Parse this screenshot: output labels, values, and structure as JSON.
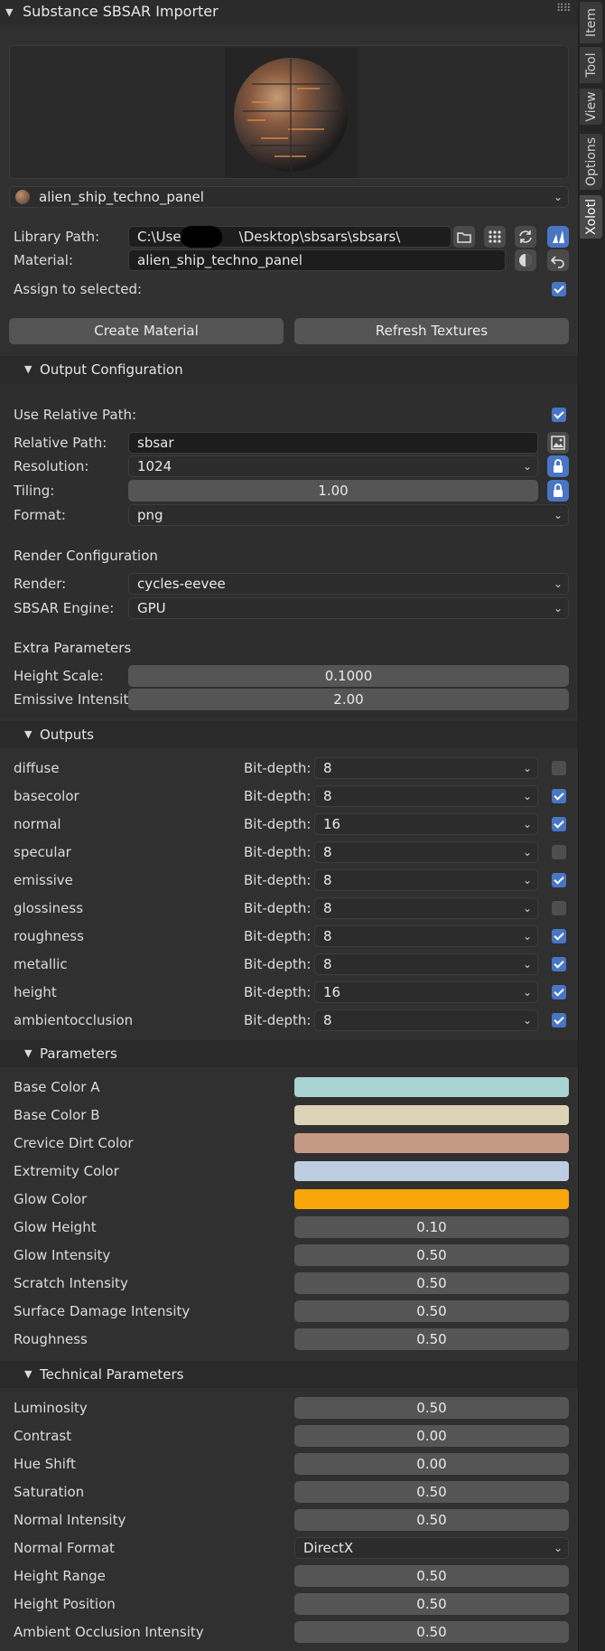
{
  "header": {
    "title": "Substance SBSAR Importer"
  },
  "side_tabs": [
    "Item",
    "Tool",
    "View",
    "Options",
    "Xolotl"
  ],
  "material_select": {
    "value": "alien_ship_techno_panel"
  },
  "library_path": {
    "label": "Library Path:",
    "value": "C:\\Users\\   \\Desktop\\sbsars\\sbsars\\"
  },
  "material": {
    "label": "Material:",
    "value": "alien_ship_techno_panel"
  },
  "assign": {
    "label": "Assign to selected:",
    "checked": true
  },
  "buttons": {
    "create": "Create Material",
    "refresh": "Refresh Textures"
  },
  "output_config": {
    "title": "Output Configuration",
    "use_relative": {
      "label": "Use Relative Path:",
      "checked": true
    },
    "relative_path": {
      "label": "Relative Path:",
      "value": "sbsar"
    },
    "resolution": {
      "label": "Resolution:",
      "value": "1024"
    },
    "tiling": {
      "label": "Tiling:",
      "value": "1.00"
    },
    "format": {
      "label": "Format:",
      "value": "png"
    },
    "render_heading": "Render Configuration",
    "render": {
      "label": "Render:",
      "value": "cycles-eevee"
    },
    "engine": {
      "label": "SBSAR Engine:",
      "value": "GPU"
    },
    "extra_heading": "Extra Parameters",
    "height_scale": {
      "label": "Height Scale:",
      "value": "0.1000"
    },
    "emissive": {
      "label": "Emissive Intensit",
      "value": "2.00"
    }
  },
  "outputs": {
    "title": "Outputs",
    "bit_label": "Bit-depth:",
    "rows": [
      {
        "name": "diffuse",
        "depth": "8",
        "checked": false
      },
      {
        "name": "basecolor",
        "depth": "8",
        "checked": true
      },
      {
        "name": "normal",
        "depth": "16",
        "checked": true
      },
      {
        "name": "specular",
        "depth": "8",
        "checked": false
      },
      {
        "name": "emissive",
        "depth": "8",
        "checked": true
      },
      {
        "name": "glossiness",
        "depth": "8",
        "checked": false
      },
      {
        "name": "roughness",
        "depth": "8",
        "checked": true
      },
      {
        "name": "metallic",
        "depth": "8",
        "checked": true
      },
      {
        "name": "height",
        "depth": "16",
        "checked": true
      },
      {
        "name": "ambientocclusion",
        "depth": "8",
        "checked": true
      }
    ]
  },
  "parameters": {
    "title": "Parameters",
    "colors": [
      {
        "label": "Base Color A",
        "color": "#a9d3d2"
      },
      {
        "label": "Base Color B",
        "color": "#dcd2b8"
      },
      {
        "label": "Crevice Dirt Color",
        "color": "#c49a84"
      },
      {
        "label": "Extremity Color",
        "color": "#bfcde2"
      },
      {
        "label": "Glow Color",
        "color": "#f8a60a"
      }
    ],
    "values": [
      {
        "label": "Glow Height",
        "value": "0.10"
      },
      {
        "label": "Glow Intensity",
        "value": "0.50"
      },
      {
        "label": "Scratch Intensity",
        "value": "0.50"
      },
      {
        "label": "Surface Damage Intensity",
        "value": "0.50"
      },
      {
        "label": "Roughness",
        "value": "0.50"
      }
    ]
  },
  "technical": {
    "title": "Technical Parameters",
    "rows": [
      {
        "label": "Luminosity",
        "value": "0.50"
      },
      {
        "label": "Contrast",
        "value": "0.00"
      },
      {
        "label": "Hue Shift",
        "value": "0.00"
      },
      {
        "label": "Saturation",
        "value": "0.50"
      },
      {
        "label": "Normal Intensity",
        "value": "0.50"
      },
      {
        "label": "Normal Format",
        "value": "DirectX",
        "dropdown": true
      },
      {
        "label": "Height Range",
        "value": "0.50"
      },
      {
        "label": "Height Position",
        "value": "0.50"
      },
      {
        "label": "Ambient Occlusion Intensity",
        "value": "0.50"
      }
    ]
  }
}
